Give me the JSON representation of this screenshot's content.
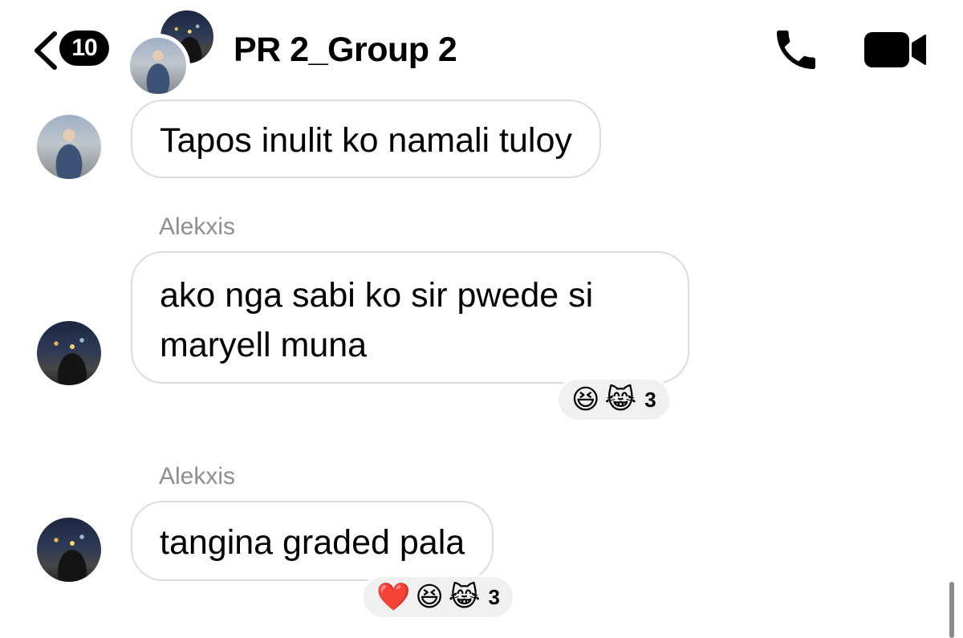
{
  "header": {
    "unread_count": "10",
    "chat_title": "PR 2_Group 2"
  },
  "messages": [
    {
      "sender": "",
      "text_lines": [
        "Tapos inulit ko namali tuloy"
      ],
      "reactions": [],
      "reaction_count": ""
    },
    {
      "sender": "Alekxis",
      "text_lines": [
        "ako nga sabi ko sir pwede si",
        "maryell muna"
      ],
      "reactions": [
        "😆",
        "😹"
      ],
      "reaction_count": "3"
    },
    {
      "sender": "Alekxis",
      "text_lines": [
        "tangina graded pala"
      ],
      "reactions": [
        "❤️",
        "😆",
        "😹"
      ],
      "reaction_count": "3"
    }
  ],
  "icons": {
    "back": "chevron-left-icon",
    "call": "phone-icon",
    "video": "video-camera-icon"
  },
  "colors": {
    "bubble_border": "#dcdcdc",
    "reaction_bg": "#f0f0f0",
    "sender_name": "#8e8e93",
    "icon": "#000000"
  }
}
